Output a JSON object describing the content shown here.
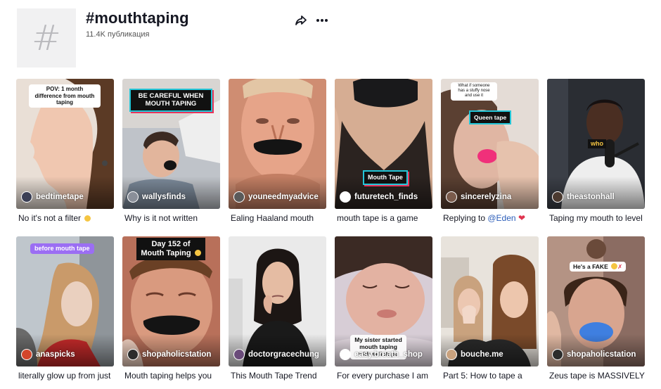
{
  "header": {
    "title": "#mouthtaping",
    "count": "11.4K публикация",
    "hash_glyph": "#"
  },
  "videos": [
    {
      "user": "bedtimetape",
      "caption": "No it's not a filter",
      "overlay": "POV: 1 month difference from mouth taping",
      "avatar_color": "#3b3f55"
    },
    {
      "user": "wallysfinds",
      "caption": "Why is it not written",
      "overlay": "BE CAREFUL WHEN MOUTH TAPING",
      "avatar_color": "#8a8f99"
    },
    {
      "user": "youneedmyadvice",
      "caption": "Ealing Haaland mouth",
      "overlay": "",
      "avatar_color": "#5a5a5a"
    },
    {
      "user": "futuretech_finds",
      "caption": "mouth tape is a game",
      "overlay": "Mouth Tape",
      "avatar_color": "#ffffff"
    },
    {
      "user": "sincerelyzina",
      "caption_prefix": "Replying to ",
      "caption_mention": "@Eden",
      "overlay": "Queen tape",
      "overlay2": "What if someone has a stuffy nose and use it",
      "avatar_color": "#7a5b4c"
    },
    {
      "user": "theastonhall",
      "caption": "Taping my mouth to level",
      "overlay": "who",
      "avatar_color": "#4b3a30"
    },
    {
      "user": "anaspicks",
      "caption": "literally glow up from just",
      "overlay": "before mouth tape",
      "avatar_color": "#d2452b"
    },
    {
      "user": "shopaholicstation",
      "caption": "Mouth taping helps you",
      "overlay": "Day 152 of Mouth Taping",
      "avatar_color": "#2c2c2c"
    },
    {
      "user": "doctorgracechung",
      "caption": "This Mouth Tape Trend",
      "overlay": "",
      "avatar_color": "#6a4b7a"
    },
    {
      "user": "easy.breath_shop",
      "caption": "For every purchase I am",
      "overlay": "My sister started mouth taping with sellotape",
      "avatar_color": "#ffffff"
    },
    {
      "user": "bouche.me",
      "caption": "Part 5: How to tape a",
      "overlay": "",
      "avatar_color": "#c9a27e"
    },
    {
      "user": "shopaholicstation",
      "caption": "Zeus tape is MASSIVELY",
      "overlay": "He's a FAKE",
      "avatar_color": "#2c2c2c"
    }
  ],
  "colors": {
    "accent_link": "#2b5db9",
    "heart": "#e0344f",
    "tape_dark": "#1b1b1d",
    "tape_pink": "#f0307a",
    "tape_blue": "#3f7fe0"
  }
}
